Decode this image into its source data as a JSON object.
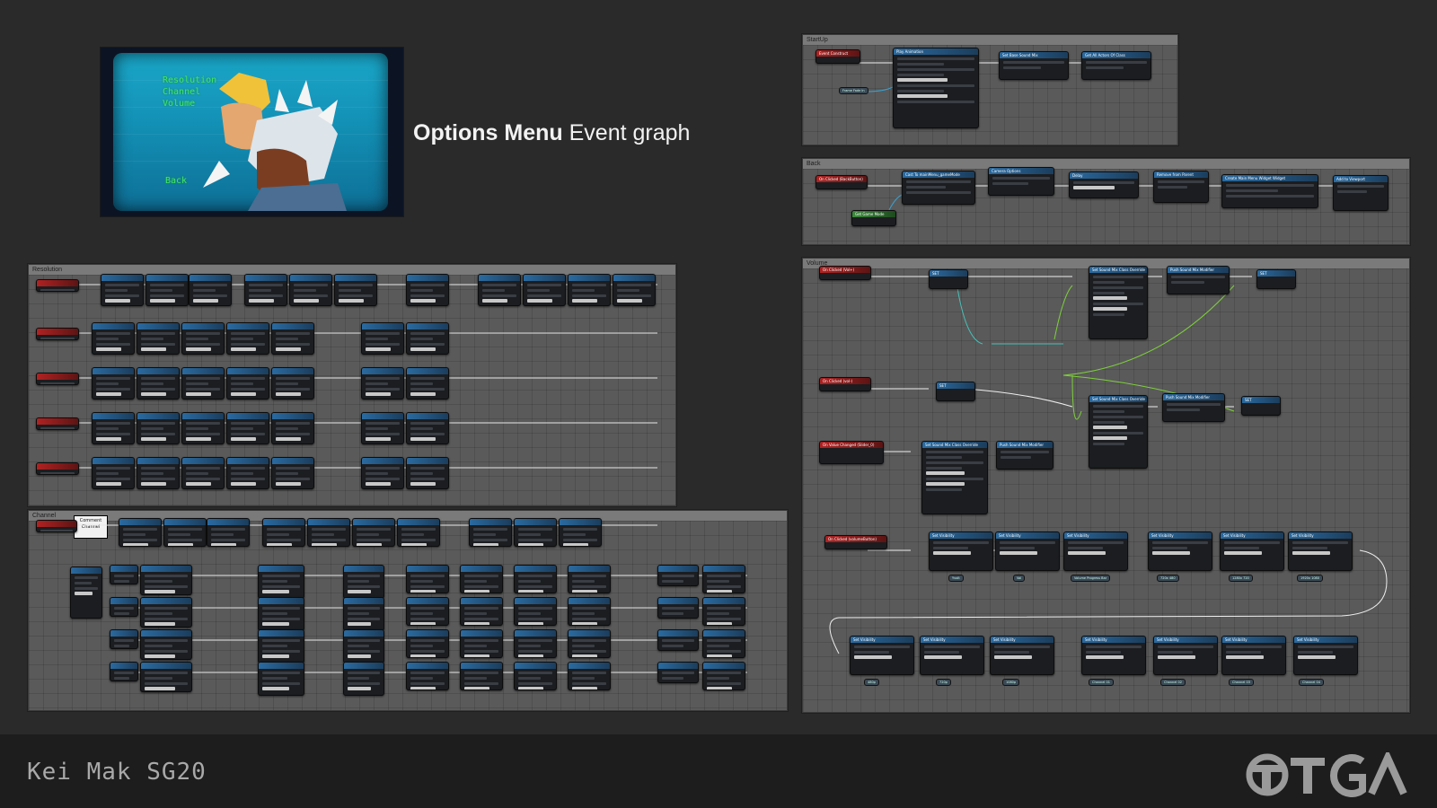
{
  "preview": {
    "menu_items": [
      "Resolution",
      "Channel",
      "Volume"
    ],
    "back_label": "Back"
  },
  "title": {
    "bold": "Options Menu",
    "light": "Event graph"
  },
  "panels": {
    "startup": {
      "label": "StartUp",
      "nodes": [
        "Event Construct",
        "Play Animation",
        "Set Base Sound Mix",
        "Get All Actors Of Class",
        "Frame Fade In"
      ]
    },
    "back": {
      "label": "Back",
      "nodes": [
        "On Clicked (BackButton)",
        "Cast To mainMenu_gameMode",
        "Camera Options",
        "Delay",
        "Remove from Parent",
        "Create Main Menu Widget Widget",
        "Add to Viewport",
        "Get Game Mode"
      ]
    },
    "volume": {
      "label": "Volume",
      "nodes": [
        "On Clicked (Vol+)",
        "SET",
        "Set Sound Mix Class Override",
        "Push Sound Mix Modifier",
        "SET",
        "On Clicked (vol-)",
        "SET",
        "Set Sound Mix Class Override",
        "Push Sound Mix Modifier",
        "SET",
        "On Value Changed (Slider_0)",
        "Set Sound Mix Class Override",
        "Push Sound Mix Modifier",
        "On Clicked (volumeButton)",
        "Set Visibility"
      ],
      "pills_top": [
        "Yvolt",
        "Vol",
        "Volume Progress Bar",
        "720x 480",
        "1280x 720",
        "1920x 1080"
      ],
      "pills_bottom": [
        "480p",
        "720p",
        "1080p",
        "Channel 01",
        "Channel 02",
        "Channel 03",
        "Channel 04"
      ]
    },
    "resolution": {
      "label": "Resolution"
    },
    "channel": {
      "label": "Channel",
      "comment": "Comment\nChannel",
      "get_label": "GET"
    }
  },
  "footer": {
    "author": "Kei Mak SG20",
    "logo": "TGA"
  },
  "colors": {
    "background": "#2a2a2a",
    "panel": "#5a5a5a",
    "node_header": "#2a6aa0",
    "event_header": "#b02222",
    "crt": "#1aa7c9",
    "menu_text": "#43e66a"
  }
}
